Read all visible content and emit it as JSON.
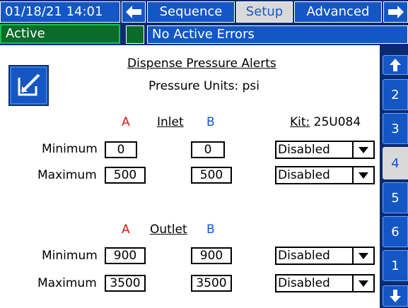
{
  "header": {
    "datetime": "01/18/21 14:01",
    "tabs": [
      {
        "label": "Sequence"
      },
      {
        "label": "Setup"
      },
      {
        "label": "Advanced"
      }
    ],
    "status": "Active",
    "errors": "No Active Errors"
  },
  "page": {
    "title": "Dispense Pressure Alerts",
    "units": "Pressure Units: psi",
    "kit": "Kit: 25U084",
    "kit_label": "Kit:",
    "kit_value": " 25U084"
  },
  "inlet": {
    "heading": "Inlet",
    "a_label": "A",
    "b_label": "B",
    "min_label": "Minimum",
    "max_label": "Maximum",
    "min_a": "0",
    "min_b": "0",
    "max_a": "500",
    "max_b": "500",
    "min_mode": "Disabled",
    "max_mode": "Disabled"
  },
  "outlet": {
    "heading": "Outlet",
    "a_label": "A",
    "b_label": "B",
    "min_label": "Minimum",
    "max_label": "Maximum",
    "min_a": "900",
    "min_b": "900",
    "max_a": "3500",
    "max_b": "3500",
    "min_mode": "Disabled",
    "max_mode": "Disabled"
  },
  "pager": {
    "tabs": [
      "2",
      "3",
      "4",
      "5",
      "6",
      "1"
    ],
    "selected": "4"
  },
  "icons": {
    "back": "arrow-left-icon",
    "forward": "arrow-right-icon",
    "up": "arrow-up-icon",
    "down": "arrow-down-icon",
    "edit": "edit-icon",
    "dropdown": "dropdown-triangle-icon"
  },
  "colors": {
    "header_bg": "#0a2b6f",
    "tab_blue": "#1457c4",
    "selected_tab": "#d9d9d9",
    "status_green": "#0d6b2a",
    "a_color": "#e01010",
    "b_color": "#1555d0"
  }
}
